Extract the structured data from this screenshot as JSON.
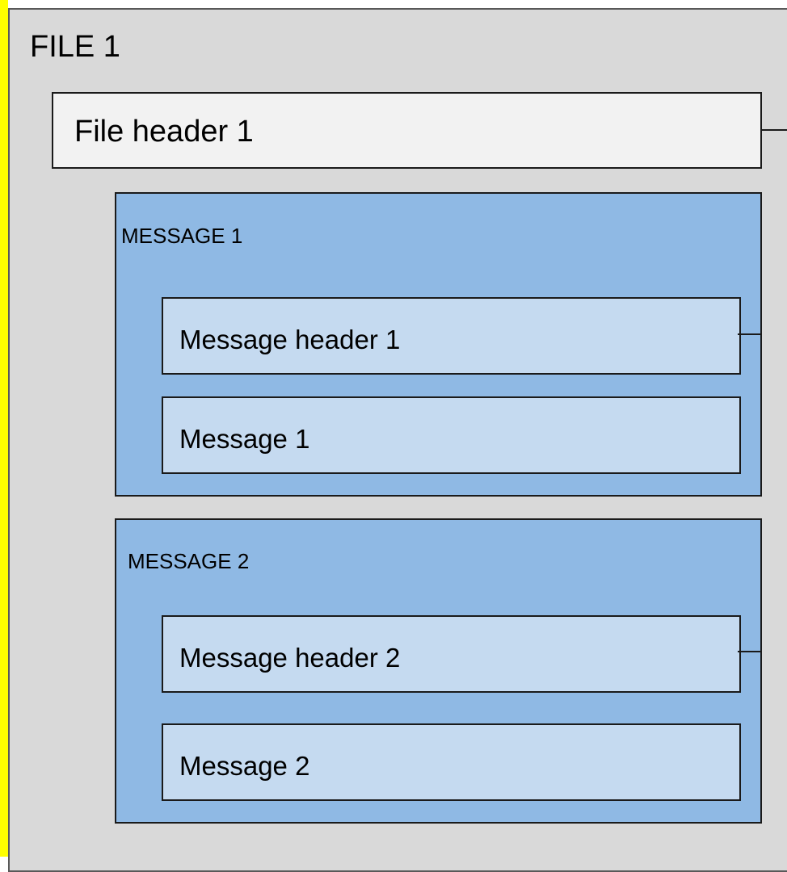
{
  "file": {
    "title": "FILE 1",
    "header_label": "File header 1"
  },
  "messages": [
    {
      "title": "MESSAGE 1",
      "header_label": "Message header 1",
      "body_label": "Message 1"
    },
    {
      "title": "MESSAGE 2",
      "header_label": "Message header 2",
      "body_label": "Message 2"
    }
  ],
  "colors": {
    "file_background": "#d9d9d9",
    "file_header_background": "#f2f2f2",
    "message_background": "#8fb9e4",
    "inner_background": "#c5daf0",
    "left_accent": "#ffff00",
    "border": "#1a1a1a"
  }
}
